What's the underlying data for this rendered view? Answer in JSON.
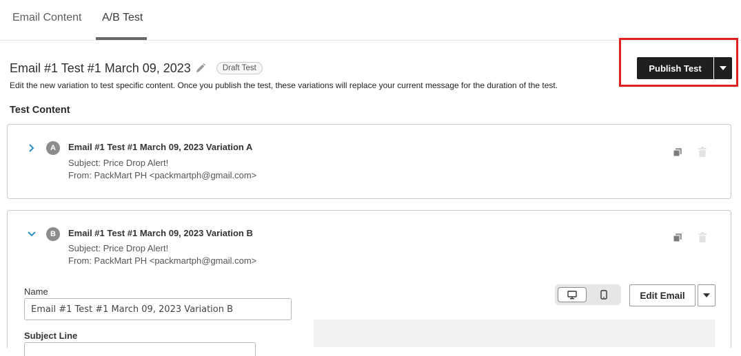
{
  "tabs": [
    {
      "label": "Email Content",
      "active": false
    },
    {
      "label": "A/B Test",
      "active": true
    }
  ],
  "header": {
    "title": "Email #1 Test #1 March 09, 2023",
    "badge": "Draft Test",
    "description": "Edit the new variation to test specific content. Once you publish the test, these variations will replace your current message for the duration of the test.",
    "publish_label": "Publish Test",
    "highlight_color": "#e02020"
  },
  "section_label": "Test Content",
  "variations": [
    {
      "letter": "A",
      "title": "Email #1 Test #1 March 09, 2023 Variation A",
      "subject": "Subject: Price Drop Alert!",
      "from": "From: PackMart PH <packmartph@gmail.com>",
      "expanded": false
    },
    {
      "letter": "B",
      "title": "Email #1 Test #1 March 09, 2023 Variation B",
      "subject": "Subject: Price Drop Alert!",
      "from": "From: PackMart PH <packmartph@gmail.com>",
      "expanded": true
    }
  ],
  "editor": {
    "name_label": "Name",
    "name_value": "Email #1 Test #1 March 09, 2023 Variation B",
    "subject_label": "Subject Line",
    "edit_email_label": "Edit Email",
    "device_selected": "desktop"
  },
  "icons": {
    "edit": "pencil-icon",
    "expand": "chevron-right-icon",
    "collapse": "chevron-down-icon",
    "duplicate": "copy-icon",
    "delete": "trash-icon",
    "desktop": "desktop-icon",
    "mobile": "mobile-icon",
    "dropdown": "caret-down-icon"
  },
  "colors": {
    "primary_button": "#1f1f22",
    "accent_chevron": "#2a8fc1",
    "letter_badge": "#8c8c8c"
  }
}
